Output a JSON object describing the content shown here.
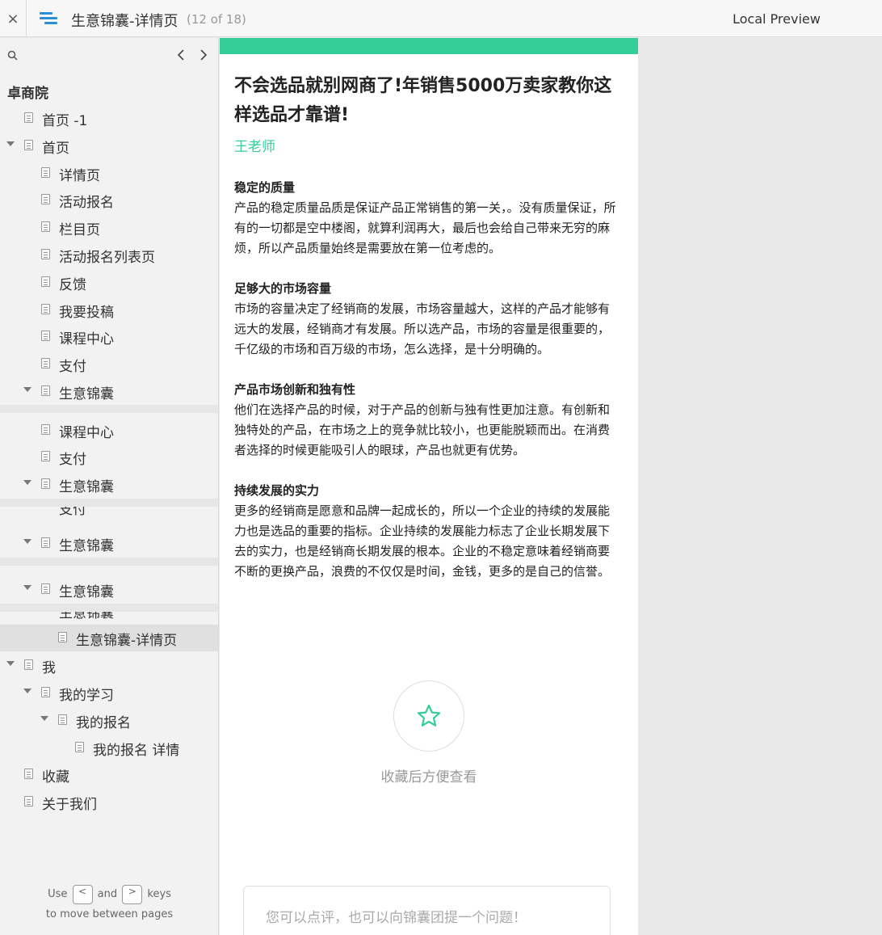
{
  "topbar": {
    "close": "×",
    "title": "生意锦囊-详情页",
    "page_count": "(12 of 18)",
    "local_preview": "Local Preview"
  },
  "sidebar": {
    "project_name": "卓商院",
    "prev": "‹",
    "next": "›",
    "items": [
      {
        "label": "首页 -1"
      },
      {
        "label": "首页"
      },
      {
        "label": "详情页"
      },
      {
        "label": "活动报名"
      },
      {
        "label": "栏目页"
      },
      {
        "label": "活动报名列表页"
      },
      {
        "label": "反馈"
      },
      {
        "label": "我要投稿"
      },
      {
        "label": "课程中心"
      },
      {
        "label": "支付"
      },
      {
        "label": "生意锦囊"
      },
      {
        "label": "课程中心"
      },
      {
        "label": "支付"
      },
      {
        "label": "生意锦囊"
      },
      {
        "label": "支付"
      },
      {
        "label": "生意锦囊"
      },
      {
        "label": "生意锦囊"
      },
      {
        "label": "生意锦囊"
      },
      {
        "label": "生意锦囊-详情页"
      },
      {
        "label": "我"
      },
      {
        "label": "我的学习"
      },
      {
        "label": "我的报名"
      },
      {
        "label": "我的报名 详情"
      },
      {
        "label": "收藏"
      },
      {
        "label": "关于我们"
      }
    ],
    "help": {
      "use": "Use",
      "key_prev": "<",
      "and": "and",
      "key_next": ">",
      "keys": "keys",
      "line2": "to move between pages"
    }
  },
  "article": {
    "title": "不会选品就别网商了!年销售5000万卖家教你这样选品才靠谱!",
    "author": "王老师",
    "sections": [
      {
        "heading": "稳定的质量",
        "body": "产品的稳定质量品质是保证产品正常销售的第一关，。没有质量保证，所有的一切都是空中楼阁，就算利润再大，最后也会给自己带来无穷的麻烦，所以产品质量始终是需要放在第一位考虑的。"
      },
      {
        "heading": "足够大的市场容量",
        "body": "市场的容量决定了经销商的发展，市场容量越大，这样的产品才能够有远大的发展，经销商才有发展。所以选产品，市场的容量是很重要的，千亿级的市场和百万级的市场，怎么选择，是十分明确的。"
      },
      {
        "heading": "产品市场创新和独有性",
        "body": "他们在选择产品的时候，对于产品的创新与独有性更加注意。有创新和独特处的产品，在市场之上的竞争就比较小，也更能脱颖而出。在消费者选择的时候更能吸引人的眼球，产品也就更有优势。"
      },
      {
        "heading": "持续发展的实力",
        "body": "更多的经销商是愿意和品牌一起成长的，所以一个企业的持续的发展能力也是选品的重要的指标。企业持续的发展能力标志了企业长期发展下去的实力，也是经销商长期发展的根本。企业的不稳定意味着经销商要不断的更换产品，浪费的不仅仅是时间，金钱，更多的是自己的信誉。"
      }
    ],
    "favorite_text": "收藏后方便查看",
    "comment_placeholder": "您可以点评，也可以向锦囊团提一个问题！"
  },
  "colors": {
    "accent_green": "#35ce98",
    "menu_blue": "#2b8fd6"
  },
  "icons": [
    "close-icon",
    "menu-icon",
    "search-icon",
    "chevron-left-icon",
    "chevron-right-icon",
    "page-icon",
    "star-icon"
  ]
}
